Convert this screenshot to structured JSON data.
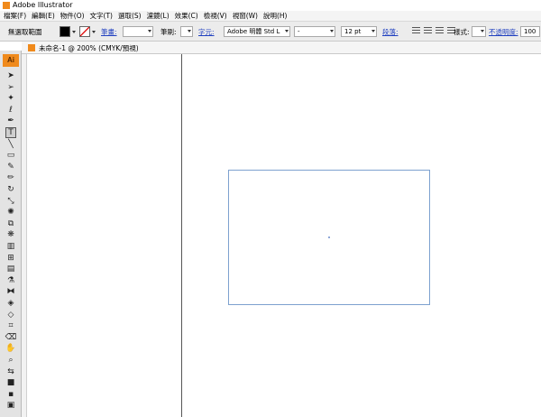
{
  "window": {
    "title": "Adobe Illustrator"
  },
  "menu": [
    "檔案(F)",
    "編輯(E)",
    "物件(O)",
    "文字(T)",
    "選取(S)",
    "濾鏡(L)",
    "效果(C)",
    "檢視(V)",
    "視窗(W)",
    "說明(H)"
  ],
  "control": {
    "selection_label": "無選取範圍",
    "stroke_label": "筆畫:",
    "brush_label": "筆刷:",
    "character_label": "字元:",
    "font_value": "Adobe 明體 Std L",
    "font_style_value": "-",
    "font_size_value": "12 pt",
    "paragraph_label": "段落:",
    "style_label": "樣式:",
    "opacity_label": "不透明度:",
    "opacity_value": "100",
    "fill_color": "#000000",
    "stroke_color": "none"
  },
  "toolbar": {
    "logo": "Ai",
    "tools": [
      {
        "name": "selection-tool-icon",
        "glyph": "➤"
      },
      {
        "name": "direct-selection-tool-icon",
        "glyph": "➢"
      },
      {
        "name": "magic-wand-tool-icon",
        "glyph": "✦"
      },
      {
        "name": "lasso-tool-icon",
        "glyph": "ℓ"
      },
      {
        "name": "pen-tool-icon",
        "glyph": "✒"
      },
      {
        "name": "type-tool-icon",
        "glyph": "T"
      },
      {
        "name": "line-tool-icon",
        "glyph": "╲"
      },
      {
        "name": "rectangle-tool-icon",
        "glyph": "▭"
      },
      {
        "name": "paintbrush-tool-icon",
        "glyph": "✎"
      },
      {
        "name": "pencil-tool-icon",
        "glyph": "✏"
      },
      {
        "name": "rotate-tool-icon",
        "glyph": "↻"
      },
      {
        "name": "scale-tool-icon",
        "glyph": "⤡"
      },
      {
        "name": "warp-tool-icon",
        "glyph": "✺"
      },
      {
        "name": "free-transform-tool-icon",
        "glyph": "⧉"
      },
      {
        "name": "symbol-sprayer-tool-icon",
        "glyph": "❋"
      },
      {
        "name": "column-graph-tool-icon",
        "glyph": "▥"
      },
      {
        "name": "mesh-tool-icon",
        "glyph": "⊞"
      },
      {
        "name": "gradient-tool-icon",
        "glyph": "▤"
      },
      {
        "name": "eyedropper-tool-icon",
        "glyph": "⚗"
      },
      {
        "name": "blend-tool-icon",
        "glyph": "⧓"
      },
      {
        "name": "live-paint-tool-icon",
        "glyph": "◈"
      },
      {
        "name": "live-paint-selection-tool-icon",
        "glyph": "◇"
      },
      {
        "name": "crop-area-tool-icon",
        "glyph": "⌗"
      },
      {
        "name": "eraser-tool-icon",
        "glyph": "⌫"
      },
      {
        "name": "hand-tool-icon",
        "glyph": "✋"
      },
      {
        "name": "zoom-tool-icon",
        "glyph": "⌕"
      },
      {
        "name": "swap-colors-icon",
        "glyph": "⇆"
      },
      {
        "name": "fill-stroke-icon",
        "glyph": "■"
      },
      {
        "name": "color-mode-icon",
        "glyph": "▪"
      },
      {
        "name": "screen-mode-icon",
        "glyph": "▣"
      }
    ]
  },
  "document": {
    "tab_label": "未命名-1 @ 200% (CMYK/預視)"
  },
  "colors": {
    "accent": "#f08a1c",
    "artboard_border": "#7da1cf",
    "link": "#2040c0"
  }
}
